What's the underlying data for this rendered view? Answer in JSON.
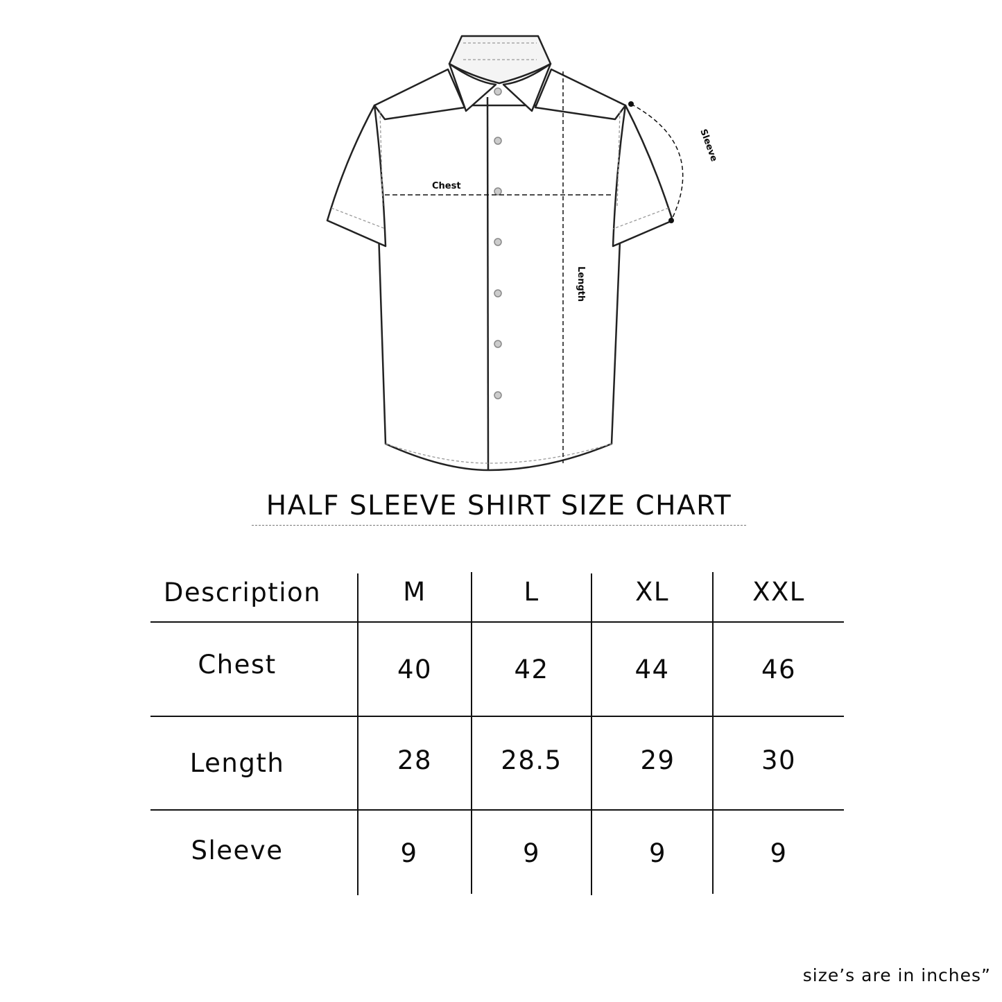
{
  "diagram": {
    "labels": {
      "chest": "Chest",
      "length": "Length",
      "sleeve": "Sleeve"
    }
  },
  "title": "HALF SLEEVE SHIRT SIZE CHART",
  "table": {
    "header": [
      "Description",
      "M",
      "L",
      "XL",
      "XXL"
    ],
    "rows": [
      {
        "label": "Chest",
        "values": [
          "40",
          "42",
          "44",
          "46"
        ]
      },
      {
        "label": "Length",
        "values": [
          "28",
          "28.5",
          "29",
          "30"
        ]
      },
      {
        "label": "Sleeve",
        "values": [
          "9",
          "9",
          "9",
          "9"
        ]
      }
    ]
  },
  "footnote": "size’s are in inches”"
}
